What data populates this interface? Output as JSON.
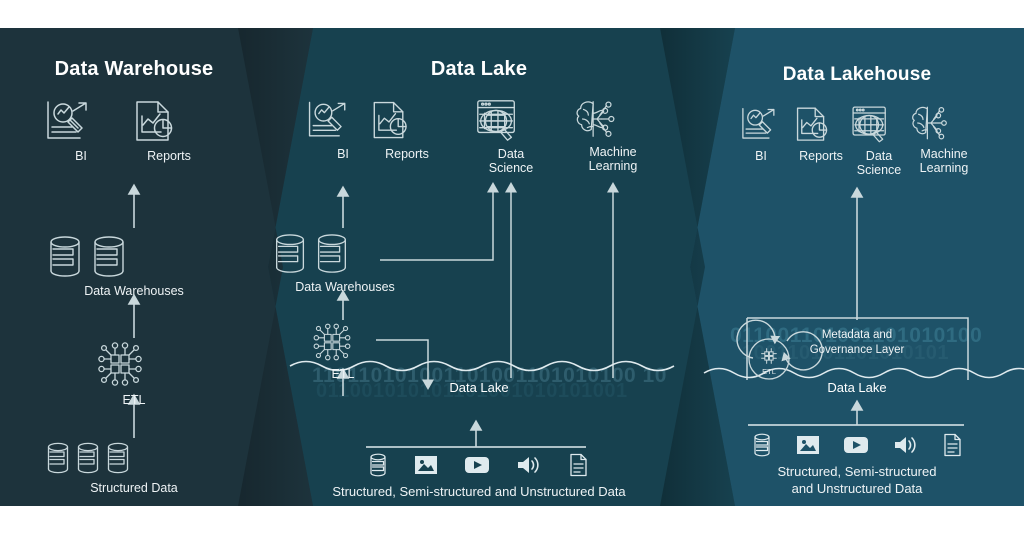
{
  "colors": {
    "panel1_bg": "#1d333c",
    "panel2_bg": "#17414f",
    "panel3_bg": "#1e5268",
    "page_bg": "#ffffff",
    "stroke": "#c9d8dc",
    "text": "#eef3f5",
    "binary": "#2a5a6b"
  },
  "panels": [
    {
      "id": "data-warehouse",
      "title": "Data Warehouse",
      "nodes": [
        {
          "key": "bi",
          "label": "BI",
          "icon": "bi-chart-magnifier-icon"
        },
        {
          "key": "reports",
          "label": "Reports",
          "icon": "report-document-icon"
        },
        {
          "key": "warehouses",
          "label": "Data Warehouses",
          "icon": "database-cylinder-icon"
        },
        {
          "key": "etl",
          "label": "ETL",
          "icon": "etl-chip-icon"
        },
        {
          "key": "structured",
          "label": "Structured Data",
          "icon": "database-cylinder-icon"
        }
      ]
    },
    {
      "id": "data-lake",
      "title": "Data Lake",
      "nodes": [
        {
          "key": "bi",
          "label": "BI",
          "icon": "bi-chart-magnifier-icon"
        },
        {
          "key": "reports",
          "label": "Reports",
          "icon": "report-document-icon"
        },
        {
          "key": "data_science",
          "label": "Data\nScience",
          "icon": "data-science-globe-icon"
        },
        {
          "key": "machine_learning",
          "label": "Machine\nLearning",
          "icon": "machine-learning-brain-icon"
        },
        {
          "key": "warehouses",
          "label": "Data Warehouses",
          "icon": "database-cylinder-icon"
        },
        {
          "key": "etl",
          "label": "ETL",
          "icon": "etl-chip-icon"
        }
      ],
      "lake_label": "Data Lake",
      "binary_top": "110110101001101001101010100 10",
      "binary_bottom": "011001010101101001010101001",
      "source_icons": [
        "database-icon",
        "image-icon",
        "video-icon",
        "audio-icon",
        "document-icon"
      ],
      "caption": "Structured, Semi-structured and Unstructured Data"
    },
    {
      "id": "data-lakehouse",
      "title": "Data Lakehouse",
      "nodes": [
        {
          "key": "bi",
          "label": "BI",
          "icon": "bi-chart-magnifier-icon"
        },
        {
          "key": "reports",
          "label": "Reports",
          "icon": "report-document-icon"
        },
        {
          "key": "data_science",
          "label": "Data\nScience",
          "icon": "data-science-globe-icon"
        },
        {
          "key": "machine_learning",
          "label": "Machine\nLearning",
          "icon": "machine-learning-brain-icon"
        }
      ],
      "governance_label": "Metadata and\nGovernance Layer",
      "etl_label": "ETL",
      "lake_label": "Data Lake",
      "binary_top": "011001101001101010100",
      "binary_bottom": "100110101101010101",
      "source_icons": [
        "database-icon",
        "image-icon",
        "video-icon",
        "audio-icon",
        "document-icon"
      ],
      "caption": "Structured, Semi-structured\nand Unstructured Data"
    }
  ]
}
